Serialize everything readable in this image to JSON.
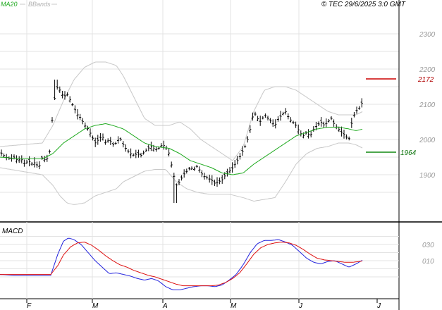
{
  "header": {
    "ma_label": "MA20",
    "bbands_label": "BBands",
    "copyright": "© TEC 29/6/2025 3:0 GMT"
  },
  "colors": {
    "ma": "#1faa1f",
    "bbands": "#c8c8c8",
    "price": "#000000",
    "macd": "#2222dd",
    "signal": "#dd1111",
    "resistance": "#cc0000",
    "support": "#118811",
    "grid": "#e3e3e3",
    "axis": "#000000"
  },
  "chart_data": [
    {
      "type": "bar",
      "panel": "price",
      "ylim": [
        1810,
        2330
      ],
      "yticks": [
        1900,
        2000,
        2100,
        2200,
        2300
      ],
      "x_months": [
        "F",
        "M",
        "A",
        "M",
        "J",
        "J"
      ],
      "resistance": {
        "value": 2172,
        "label": "2172"
      },
      "support": {
        "value": 1964,
        "label": "1964"
      },
      "price_anchors": [
        [
          0,
          1965
        ],
        [
          8,
          1950
        ],
        [
          15,
          1945
        ],
        [
          20,
          1950
        ],
        [
          25,
          1940
        ],
        [
          30,
          1945
        ],
        [
          35,
          1930
        ],
        [
          40,
          1940
        ],
        [
          45,
          1930
        ],
        [
          50,
          1935
        ],
        [
          55,
          1920
        ],
        [
          60,
          1950
        ],
        [
          65,
          1940
        ],
        [
          70,
          1955
        ],
        [
          75,
          2080
        ],
        [
          80,
          2150
        ],
        [
          85,
          2140
        ],
        [
          90,
          2120
        ],
        [
          95,
          2130
        ],
        [
          100,
          2110
        ],
        [
          105,
          2090
        ],
        [
          110,
          2070
        ],
        [
          115,
          2060
        ],
        [
          120,
          2040
        ],
        [
          125,
          2030
        ],
        [
          130,
          2010
        ],
        [
          135,
          1990
        ],
        [
          140,
          2000
        ],
        [
          145,
          2010
        ],
        [
          150,
          1990
        ],
        [
          155,
          2000
        ],
        [
          160,
          1985
        ],
        [
          165,
          1990
        ],
        [
          170,
          2005
        ],
        [
          175,
          1985
        ],
        [
          180,
          1970
        ],
        [
          185,
          1960
        ],
        [
          190,
          1955
        ],
        [
          195,
          1960
        ],
        [
          200,
          1955
        ],
        [
          205,
          1965
        ],
        [
          210,
          1975
        ],
        [
          215,
          1980
        ],
        [
          220,
          1970
        ],
        [
          225,
          1975
        ],
        [
          230,
          1985
        ],
        [
          235,
          1980
        ],
        [
          240,
          1960
        ],
        [
          245,
          1910
        ],
        [
          250,
          1870
        ],
        [
          255,
          1880
        ],
        [
          260,
          1900
        ],
        [
          265,
          1910
        ],
        [
          270,
          1920
        ],
        [
          275,
          1915
        ],
        [
          280,
          1925
        ],
        [
          285,
          1905
        ],
        [
          290,
          1895
        ],
        [
          295,
          1890
        ],
        [
          300,
          1885
        ],
        [
          305,
          1875
        ],
        [
          310,
          1880
        ],
        [
          315,
          1885
        ],
        [
          320,
          1900
        ],
        [
          325,
          1910
        ],
        [
          330,
          1920
        ],
        [
          335,
          1935
        ],
        [
          340,
          1950
        ],
        [
          345,
          1970
        ],
        [
          350,
          1990
        ],
        [
          355,
          2030
        ],
        [
          360,
          2080
        ],
        [
          365,
          2060
        ],
        [
          370,
          2050
        ],
        [
          375,
          2070
        ],
        [
          380,
          2060
        ],
        [
          385,
          2050
        ],
        [
          390,
          2040
        ],
        [
          395,
          2060
        ],
        [
          400,
          2070
        ],
        [
          405,
          2080
        ],
        [
          410,
          2060
        ],
        [
          415,
          2050
        ],
        [
          420,
          2040
        ],
        [
          425,
          2020
        ],
        [
          430,
          2010
        ],
        [
          435,
          2020
        ],
        [
          440,
          2010
        ],
        [
          445,
          2030
        ],
        [
          450,
          2040
        ],
        [
          455,
          2050
        ],
        [
          460,
          2040
        ],
        [
          465,
          2050
        ],
        [
          470,
          2060
        ],
        [
          475,
          2040
        ],
        [
          480,
          2030
        ],
        [
          485,
          2020
        ],
        [
          490,
          2010
        ],
        [
          495,
          2000
        ],
        [
          500,
          2060
        ],
        [
          505,
          2080
        ],
        [
          510,
          2090
        ],
        [
          515,
          2110
        ]
      ],
      "ma_anchors": [
        [
          0,
          1950
        ],
        [
          30,
          1945
        ],
        [
          60,
          1945
        ],
        [
          75,
          1960
        ],
        [
          90,
          1990
        ],
        [
          105,
          2010
        ],
        [
          120,
          2030
        ],
        [
          135,
          2040
        ],
        [
          150,
          2045
        ],
        [
          160,
          2040
        ],
        [
          175,
          2030
        ],
        [
          190,
          2010
        ],
        [
          205,
          1990
        ],
        [
          220,
          1980
        ],
        [
          240,
          1975
        ],
        [
          255,
          1960
        ],
        [
          270,
          1940
        ],
        [
          285,
          1930
        ],
        [
          300,
          1920
        ],
        [
          315,
          1905
        ],
        [
          330,
          1900
        ],
        [
          345,
          1905
        ],
        [
          360,
          1930
        ],
        [
          375,
          1950
        ],
        [
          390,
          1970
        ],
        [
          405,
          1990
        ],
        [
          420,
          2010
        ],
        [
          435,
          2020
        ],
        [
          450,
          2030
        ],
        [
          465,
          2035
        ],
        [
          480,
          2035
        ],
        [
          495,
          2030
        ],
        [
          505,
          2025
        ],
        [
          515,
          2030
        ]
      ],
      "bb_upper_anchors": [
        [
          0,
          1980
        ],
        [
          30,
          1985
        ],
        [
          60,
          1990
        ],
        [
          75,
          2040
        ],
        [
          90,
          2110
        ],
        [
          105,
          2170
        ],
        [
          120,
          2205
        ],
        [
          135,
          2220
        ],
        [
          150,
          2220
        ],
        [
          165,
          2210
        ],
        [
          175,
          2180
        ],
        [
          190,
          2120
        ],
        [
          205,
          2060
        ],
        [
          220,
          2040
        ],
        [
          240,
          2040
        ],
        [
          255,
          2050
        ],
        [
          270,
          2030
        ],
        [
          285,
          2000
        ],
        [
          300,
          1980
        ],
        [
          315,
          1960
        ],
        [
          330,
          1940
        ],
        [
          345,
          1980
        ],
        [
          360,
          2080
        ],
        [
          375,
          2140
        ],
        [
          390,
          2150
        ],
        [
          405,
          2150
        ],
        [
          420,
          2140
        ],
        [
          435,
          2120
        ],
        [
          450,
          2100
        ],
        [
          465,
          2080
        ],
        [
          480,
          2070
        ],
        [
          495,
          2070
        ],
        [
          505,
          2070
        ],
        [
          515,
          2080
        ]
      ],
      "bb_lower_anchors": [
        [
          0,
          1920
        ],
        [
          30,
          1910
        ],
        [
          60,
          1900
        ],
        [
          75,
          1870
        ],
        [
          85,
          1840
        ],
        [
          95,
          1820
        ],
        [
          105,
          1815
        ],
        [
          120,
          1820
        ],
        [
          135,
          1840
        ],
        [
          150,
          1850
        ],
        [
          165,
          1860
        ],
        [
          175,
          1880
        ],
        [
          190,
          1895
        ],
        [
          205,
          1910
        ],
        [
          220,
          1915
        ],
        [
          235,
          1915
        ],
        [
          250,
          1880
        ],
        [
          265,
          1860
        ],
        [
          280,
          1850
        ],
        [
          295,
          1845
        ],
        [
          310,
          1845
        ],
        [
          325,
          1845
        ],
        [
          345,
          1835
        ],
        [
          360,
          1825
        ],
        [
          375,
          1830
        ],
        [
          390,
          1835
        ],
        [
          405,
          1880
        ],
        [
          420,
          1930
        ],
        [
          435,
          1960
        ],
        [
          450,
          1975
        ],
        [
          465,
          1980
        ],
        [
          480,
          1990
        ],
        [
          495,
          1990
        ],
        [
          505,
          1985
        ],
        [
          515,
          1975
        ]
      ]
    },
    {
      "type": "line",
      "panel": "macd",
      "title": "MACD",
      "ylim": [
        -10,
        45
      ],
      "yticks": [
        10,
        30
      ],
      "ytick_labels": [
        "010",
        "030"
      ],
      "x_months": [
        "F",
        "M",
        "A",
        "M",
        "J",
        "J"
      ],
      "series": [
        {
          "role": "macd",
          "anchors": [
            [
              0,
              -7
            ],
            [
              20,
              -8
            ],
            [
              40,
              -8
            ],
            [
              60,
              -8
            ],
            [
              72,
              -8
            ],
            [
              82,
              18
            ],
            [
              90,
              34
            ],
            [
              97,
              38
            ],
            [
              105,
              36
            ],
            [
              115,
              30
            ],
            [
              125,
              20
            ],
            [
              135,
              10
            ],
            [
              145,
              2
            ],
            [
              155,
              -6
            ],
            [
              165,
              -5
            ],
            [
              175,
              -7
            ],
            [
              185,
              -9
            ],
            [
              195,
              -12
            ],
            [
              205,
              -14
            ],
            [
              215,
              -12
            ],
            [
              225,
              -15
            ],
            [
              235,
              -22
            ],
            [
              245,
              -26
            ],
            [
              255,
              -26
            ],
            [
              265,
              -24
            ],
            [
              275,
              -22
            ],
            [
              285,
              -21
            ],
            [
              295,
              -21
            ],
            [
              305,
              -22
            ],
            [
              315,
              -20
            ],
            [
              325,
              -14
            ],
            [
              335,
              -7
            ],
            [
              345,
              5
            ],
            [
              355,
              20
            ],
            [
              365,
              31
            ],
            [
              375,
              35
            ],
            [
              385,
              35
            ],
            [
              395,
              36
            ],
            [
              405,
              33
            ],
            [
              415,
              29
            ],
            [
              425,
              21
            ],
            [
              435,
              13
            ],
            [
              445,
              8
            ],
            [
              455,
              6
            ],
            [
              465,
              9
            ],
            [
              475,
              10
            ],
            [
              485,
              6
            ],
            [
              495,
              2
            ],
            [
              505,
              6
            ],
            [
              515,
              11
            ]
          ]
        },
        {
          "role": "signal",
          "anchors": [
            [
              0,
              -7
            ],
            [
              20,
              -7
            ],
            [
              40,
              -7
            ],
            [
              60,
              -7
            ],
            [
              72,
              -7
            ],
            [
              82,
              4
            ],
            [
              90,
              17
            ],
            [
              100,
              27
            ],
            [
              110,
              32
            ],
            [
              120,
              33
            ],
            [
              130,
              29
            ],
            [
              140,
              23
            ],
            [
              150,
              16
            ],
            [
              160,
              10
            ],
            [
              170,
              5
            ],
            [
              180,
              2
            ],
            [
              190,
              -2
            ],
            [
              200,
              -5
            ],
            [
              210,
              -8
            ],
            [
              220,
              -10
            ],
            [
              230,
              -13
            ],
            [
              240,
              -16
            ],
            [
              250,
              -19
            ],
            [
              260,
              -21
            ],
            [
              270,
              -21
            ],
            [
              280,
              -21
            ],
            [
              290,
              -21
            ],
            [
              300,
              -21
            ],
            [
              310,
              -20
            ],
            [
              320,
              -17
            ],
            [
              330,
              -12
            ],
            [
              340,
              -5
            ],
            [
              350,
              6
            ],
            [
              360,
              18
            ],
            [
              370,
              26
            ],
            [
              380,
              30
            ],
            [
              390,
              32
            ],
            [
              400,
              33
            ],
            [
              410,
              32
            ],
            [
              420,
              29
            ],
            [
              430,
              24
            ],
            [
              440,
              18
            ],
            [
              450,
              13
            ],
            [
              460,
              11
            ],
            [
              470,
              10
            ],
            [
              480,
              9
            ],
            [
              490,
              8
            ],
            [
              500,
              8
            ],
            [
              510,
              9
            ],
            [
              515,
              10
            ]
          ]
        }
      ]
    }
  ]
}
